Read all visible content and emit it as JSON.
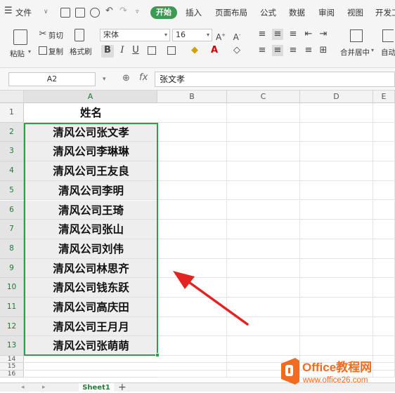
{
  "menubar": {
    "file_label": "文件",
    "start_label": "开始",
    "tabs": [
      "插入",
      "页面布局",
      "公式",
      "数据",
      "审阅",
      "视图",
      "开发工"
    ]
  },
  "ribbon": {
    "paste_label": "粘贴",
    "cut_label": "剪切",
    "copy_label": "复制",
    "format_painter_label": "格式刷",
    "font_name": "宋体",
    "font_size": "16",
    "merge_center_label": "合并居中",
    "auto_wrap_label": "自动",
    "bold": "B",
    "italic": "I",
    "underline": "U"
  },
  "formula_bar": {
    "name_box": "A2",
    "fx": "fx",
    "value": "张文孝"
  },
  "grid": {
    "columns": [
      "A",
      "B",
      "C",
      "D",
      "E"
    ],
    "rows": [
      "1",
      "2",
      "3",
      "4",
      "5",
      "6",
      "7",
      "8",
      "9",
      "10",
      "11",
      "12",
      "13",
      "14",
      "15",
      "16"
    ],
    "header_cell": "姓名",
    "cells": [
      "清风公司张文孝",
      "清风公司李琳琳",
      "清风公司王友良",
      "清风公司李明",
      "清风公司王琦",
      "清风公司张山",
      "清风公司刘伟",
      "清风公司林思齐",
      "清风公司钱东跃",
      "清风公司高庆田",
      "清风公司王月月",
      "清风公司张萌萌"
    ]
  },
  "sheets": {
    "active": "Sheet1",
    "add": "+"
  },
  "watermark": {
    "brand": "Office教程网",
    "url": "www.office26.com"
  },
  "colors": {
    "accent": "#3c9a52",
    "selection_border": "#2f9e4a",
    "arrow": "#e32222",
    "logo_orange": "#f26b21"
  }
}
